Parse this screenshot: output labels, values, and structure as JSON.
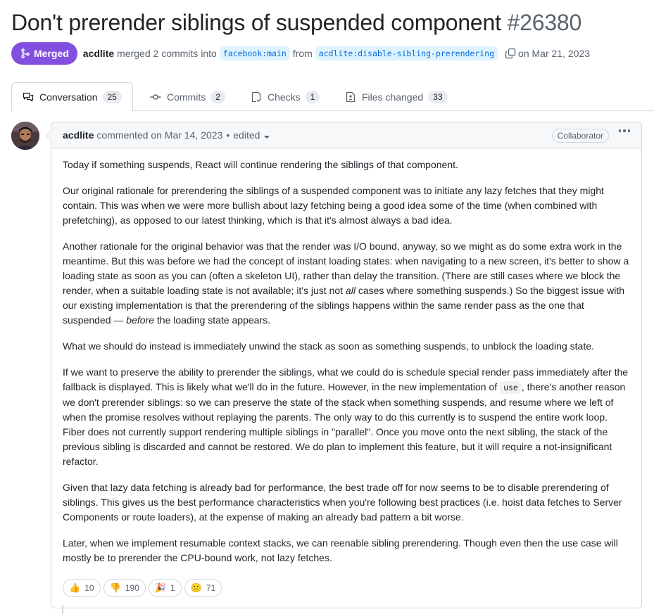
{
  "pr": {
    "title": "Don't prerender siblings of suspended component",
    "number": "#26380",
    "state": "Merged",
    "author": "acdlite",
    "merge_text": "merged 2 commits into",
    "base_branch": "facebook:main",
    "from_text": "from",
    "head_branch": "acdlite:disable-sibling-prerendering",
    "date_text": "on Mar 21, 2023"
  },
  "tabs": [
    {
      "label": "Conversation",
      "count": "25",
      "icon": "comment-discussion-icon"
    },
    {
      "label": "Commits",
      "count": "2",
      "icon": "git-commit-icon"
    },
    {
      "label": "Checks",
      "count": "1",
      "icon": "checklist-icon"
    },
    {
      "label": "Files changed",
      "count": "33",
      "icon": "file-diff-icon"
    }
  ],
  "comment": {
    "author": "acdlite",
    "action": "commented on Mar 14, 2023",
    "separator": "•",
    "edited": "edited",
    "role": "Collaborator",
    "p1": "Today if something suspends, React will continue rendering the siblings of that component.",
    "p2": "Our original rationale for prerendering the siblings of a suspended component was to initiate any lazy fetches that they might contain. This was when we were more bullish about lazy fetching being a good idea some of the time (when combined with prefetching), as opposed to our latest thinking, which is that it's almost always a bad idea.",
    "p3a": "Another rationale for the original behavior was that the render was I/O bound, anyway, so we might as do some extra work in the meantime. But this was before we had the concept of instant loading states: when navigating to a new screen, it's better to show a loading state as soon as you can (often a skeleton UI), rather than delay the transition. (There are still cases where we block the render, when a suitable loading state is not available; it's just not ",
    "p3b": "all",
    "p3c": " cases where something suspends.) So the biggest issue with our existing implementation is that the prerendering of the siblings happens within the same render pass as the one that suspended — ",
    "p3d": "before",
    "p3e": " the loading state appears.",
    "p4": "What we should do instead is immediately unwind the stack as soon as something suspends, to unblock the loading state.",
    "p5a": "If we want to preserve the ability to prerender the siblings, what we could do is schedule special render pass immediately after the fallback is displayed. This is likely what we'll do in the future. However, in the new implementation of ",
    "p5code": "use",
    "p5b": ", there's another reason we don't prerender siblings: so we can preserve the state of the stack when something suspends, and resume where we left of when the promise resolves without replaying the parents. The only way to do this currently is to suspend the entire work loop. Fiber does not currently support rendering multiple siblings in \"parallel\". Once you move onto the next sibling, the stack of the previous sibling is discarded and cannot be restored. We do plan to implement this feature, but it will require a not-insignificant refactor.",
    "p6": "Given that lazy data fetching is already bad for performance, the best trade off for now seems to be to disable prerendering of siblings. This gives us the best performance characteristics when you're following best practices (i.e. hoist data fetches to Server Components or route loaders), at the expense of making an already bad pattern a bit worse.",
    "p7": "Later, when we implement resumable context stacks, we can reenable sibling prerendering. Though even then the use case will mostly be to prerender the CPU-bound work, not lazy fetches."
  },
  "reactions": [
    {
      "emoji": "👍",
      "name": "thumbs-up",
      "count": "10"
    },
    {
      "emoji": "👎",
      "name": "thumbs-down",
      "count": "190"
    },
    {
      "emoji": "🎉",
      "name": "hooray",
      "count": "1"
    },
    {
      "emoji": "😕",
      "name": "confused",
      "count": "71"
    }
  ],
  "colors": {
    "merged": "#8250df",
    "branch_bg": "#ddf4ff",
    "branch_fg": "#0969da",
    "border": "#d1d9e0",
    "muted": "#59636e"
  }
}
